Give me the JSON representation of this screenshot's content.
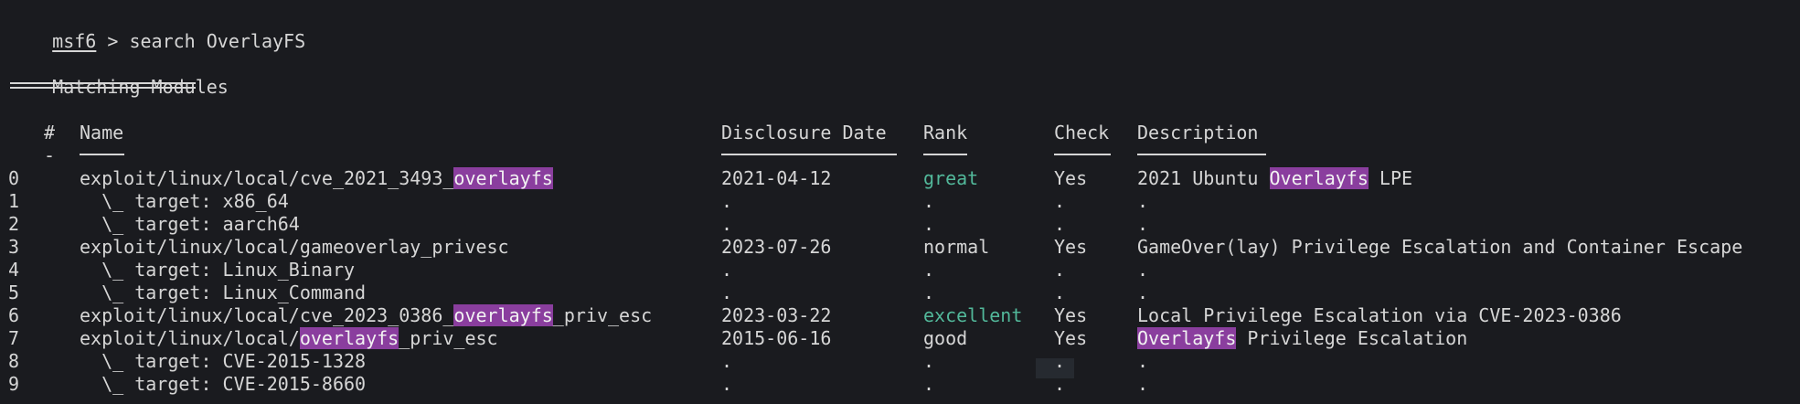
{
  "prompt": {
    "name": "msf6",
    "sep": " > ",
    "command": "search OverlayFS"
  },
  "section_title": "Matching Modules",
  "columns": {
    "num": "#",
    "name": "Name",
    "date": "Disclosure Date",
    "rank": "Rank",
    "check": "Check",
    "desc": "Description"
  },
  "header_dash": "-",
  "rows": [
    {
      "num": "0",
      "name_pre": "exploit/linux/local/cve_2021_3493_",
      "name_hl": "overlayfs",
      "name_post": "",
      "date": "2021-04-12",
      "rank": "great",
      "check": "Yes",
      "desc_pre": "2021 Ubuntu ",
      "desc_hl": "Overlayfs",
      "desc_post": " LPE"
    },
    {
      "num": "1",
      "name_pre": "  \\_ target: x86_64",
      "name_hl": "",
      "name_post": "",
      "date": ".",
      "rank": ".",
      "check": ".",
      "desc_pre": ".",
      "desc_hl": "",
      "desc_post": ""
    },
    {
      "num": "2",
      "name_pre": "  \\_ target: aarch64",
      "name_hl": "",
      "name_post": "",
      "date": ".",
      "rank": ".",
      "check": ".",
      "desc_pre": ".",
      "desc_hl": "",
      "desc_post": ""
    },
    {
      "num": "3",
      "name_pre": "exploit/linux/local/gameoverlay_privesc",
      "name_hl": "",
      "name_post": "",
      "date": "2023-07-26",
      "rank": "normal",
      "check": "Yes",
      "desc_pre": "GameOver(lay) Privilege Escalation and Container Escape",
      "desc_hl": "",
      "desc_post": ""
    },
    {
      "num": "4",
      "name_pre": "  \\_ target: Linux_Binary",
      "name_hl": "",
      "name_post": "",
      "date": ".",
      "rank": ".",
      "check": ".",
      "desc_pre": ".",
      "desc_hl": "",
      "desc_post": ""
    },
    {
      "num": "5",
      "name_pre": "  \\_ target: Linux_Command",
      "name_hl": "",
      "name_post": "",
      "date": ".",
      "rank": ".",
      "check": ".",
      "desc_pre": ".",
      "desc_hl": "",
      "desc_post": ""
    },
    {
      "num": "6",
      "name_pre": "exploit/linux/local/cve_2023_0386_",
      "name_hl": "overlayfs",
      "name_post": "_priv_esc",
      "date": "2023-03-22",
      "rank": "excellent",
      "check": "Yes",
      "desc_pre": "Local Privilege Escalation via CVE-2023-0386",
      "desc_hl": "",
      "desc_post": ""
    },
    {
      "num": "7",
      "name_pre": "exploit/linux/local/",
      "name_hl": "overlayfs",
      "name_post": "_priv_esc",
      "date": "2015-06-16",
      "rank": "good",
      "check": "Yes",
      "desc_pre": "",
      "desc_hl": "Overlayfs",
      "desc_post": " Privilege Escalation"
    },
    {
      "num": "8",
      "name_pre": "  \\_ target: CVE-2015-1328",
      "name_hl": "",
      "name_post": "",
      "date": ".",
      "rank": ".",
      "check": ".",
      "desc_pre": ".",
      "desc_hl": "",
      "desc_post": ""
    },
    {
      "num": "9",
      "name_pre": "  \\_ target: CVE-2015-8660",
      "name_hl": "",
      "name_post": "",
      "date": ".",
      "rank": ".",
      "check": ".",
      "desc_pre": ".",
      "desc_hl": "",
      "desc_post": ""
    }
  ],
  "colors": {
    "background": "#1a1b1f",
    "text": "#d6d6d6",
    "highlight": "#8a3e9e",
    "rank_good": "#52b89a"
  }
}
